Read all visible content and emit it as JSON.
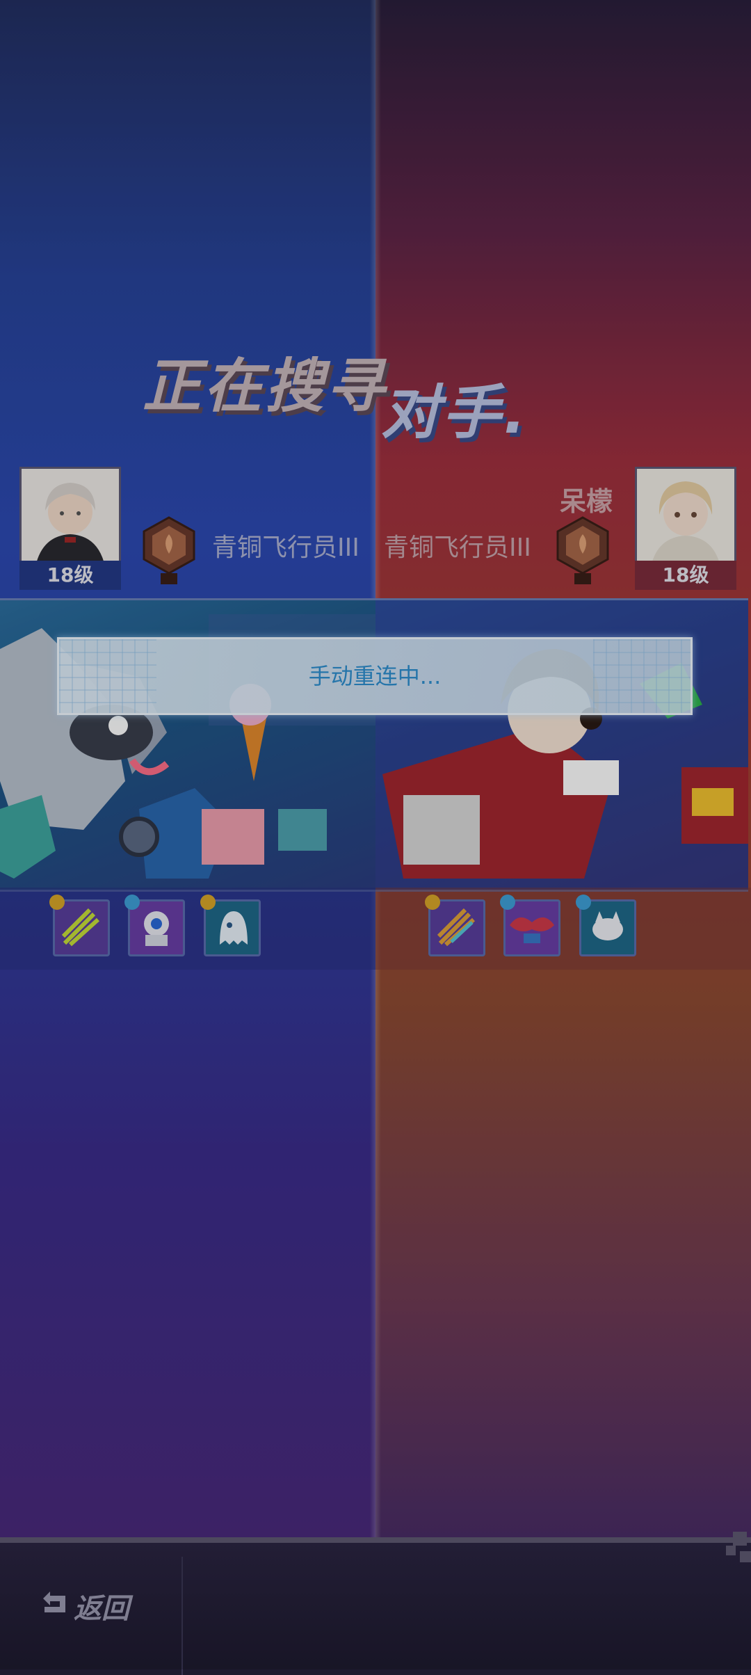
{
  "search": {
    "title_left": "正在搜寻",
    "title_right": "对手."
  },
  "player": {
    "level": "18级",
    "rank": "青铜飞行员III",
    "rank_numeral": "III"
  },
  "opponent": {
    "name": "呆檬",
    "level": "18级",
    "rank": "青铜飞行员III",
    "rank_numeral": "III"
  },
  "dialog": {
    "message": "手动重连中..."
  },
  "footer": {
    "back_label": "返回"
  },
  "colors": {
    "team_blue": "#2c4ab3",
    "team_red": "#a0303f",
    "dialog_text": "#2e8fd0"
  },
  "icons": {
    "player_items": [
      "rocket-item-icon",
      "robot-pet-icon",
      "ghost-pet-icon"
    ],
    "opponent_items": [
      "rocket-item-icon",
      "bat-wing-icon",
      "cat-pet-icon"
    ]
  }
}
